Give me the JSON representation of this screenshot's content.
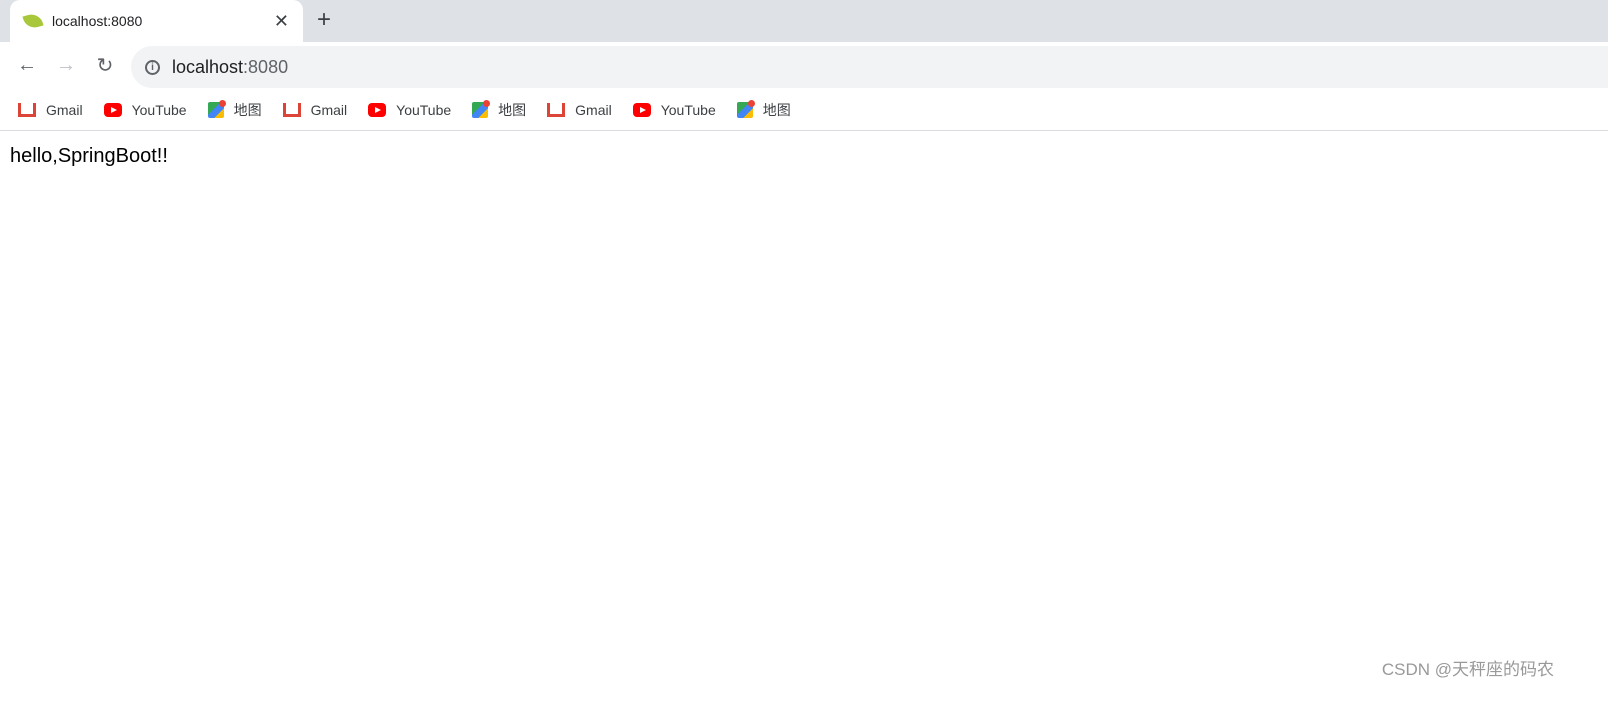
{
  "tab": {
    "title": "localhost:8080",
    "favicon": "spring-leaf-icon"
  },
  "omnibox": {
    "host": "localhost",
    "port": ":8080"
  },
  "bookmarks": [
    {
      "label": "Gmail",
      "icon": "gmail-icon"
    },
    {
      "label": "YouTube",
      "icon": "youtube-icon"
    },
    {
      "label": "地图",
      "icon": "maps-icon"
    },
    {
      "label": "Gmail",
      "icon": "gmail-icon"
    },
    {
      "label": "YouTube",
      "icon": "youtube-icon"
    },
    {
      "label": "地图",
      "icon": "maps-icon"
    },
    {
      "label": "Gmail",
      "icon": "gmail-icon"
    },
    {
      "label": "YouTube",
      "icon": "youtube-icon"
    },
    {
      "label": "地图",
      "icon": "maps-icon"
    }
  ],
  "page": {
    "text": "hello,SpringBoot!!"
  },
  "watermark": "CSDN @天秤座的码农"
}
